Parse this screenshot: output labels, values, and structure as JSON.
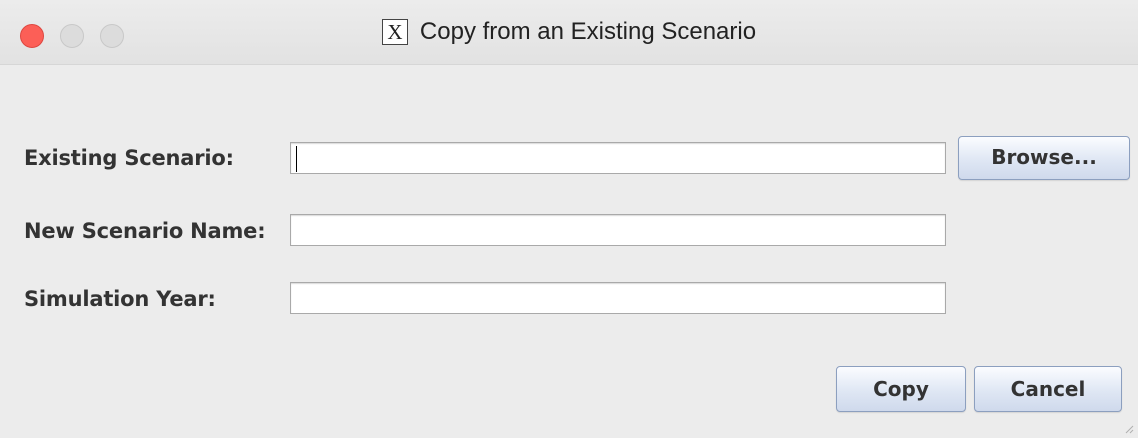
{
  "window": {
    "title": "Copy from an Existing Scenario",
    "app_icon": "X"
  },
  "form": {
    "existing_scenario_label": "Existing Scenario:",
    "existing_scenario_value": "",
    "new_scenario_name_label": "New Scenario Name:",
    "new_scenario_name_value": "",
    "simulation_year_label": "Simulation Year:",
    "simulation_year_value": ""
  },
  "buttons": {
    "browse": "Browse...",
    "copy": "Copy",
    "cancel": "Cancel"
  },
  "icons": {
    "close": "close-icon",
    "minimize": "minimize-icon",
    "zoom": "zoom-icon",
    "app": "x11-app-icon"
  },
  "colors": {
    "close_button": "#fc5f57",
    "inactive_button": "#dcdcdc",
    "window_background": "#ececec"
  }
}
